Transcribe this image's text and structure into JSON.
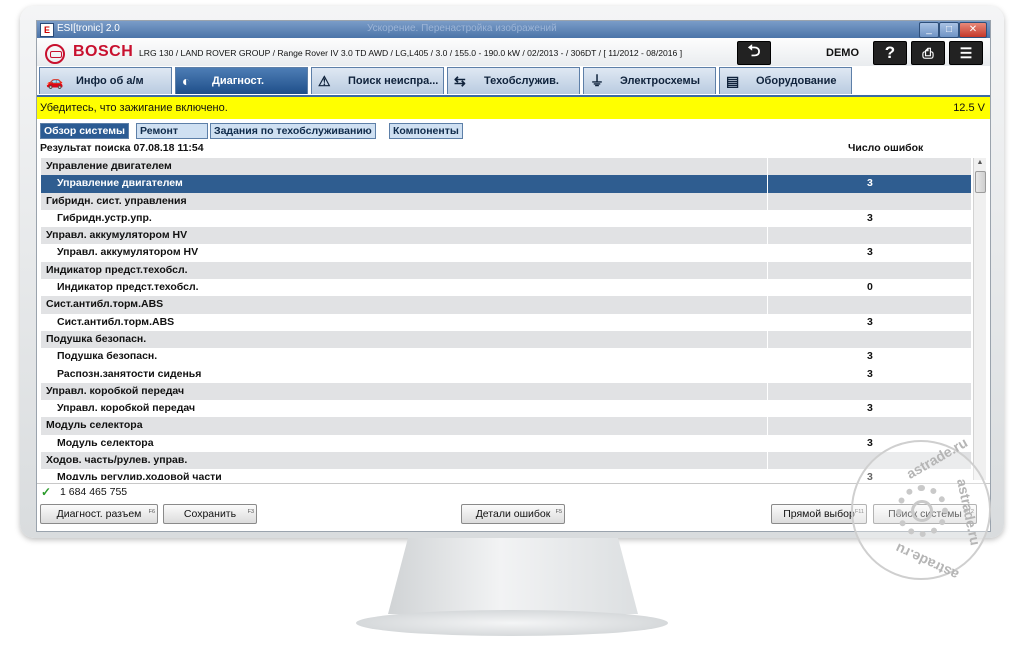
{
  "window": {
    "title": "ESI[tronic] 2.0",
    "ghost_title": "Ускорение. Перенастройка изображений",
    "controls": {
      "minimize": "_",
      "maximize": "□",
      "close": "✕"
    }
  },
  "header": {
    "brand": "BOSCH",
    "vehicle": "LRG 130 / LAND ROVER GROUP / Range Rover IV 3.0 TD AWD / LG,L405 / 3.0 / 155.0 - 190.0 kW / 02/2013 - / 306DT / [ 11/2012 - 08/2016 ]",
    "mode": "DEMO",
    "icons": {
      "back": "back-arrow-icon",
      "help": "help-icon",
      "print": "printer-icon",
      "menu": "menu-icon"
    },
    "glyphs": {
      "back": "⮌",
      "help": "?",
      "print": "⎙",
      "menu": "☰"
    }
  },
  "main_tabs": [
    {
      "label": "Инфо об а/м",
      "icon": "car-info-icon",
      "glyph": "🚗"
    },
    {
      "label": "Диагност.",
      "icon": "diagnostics-icon",
      "glyph": "◐"
    },
    {
      "label": "Поиск неиспра...",
      "icon": "fault-search-icon",
      "glyph": "⚠"
    },
    {
      "label": "Техобслужив.",
      "icon": "service-icon",
      "glyph": "⇆"
    },
    {
      "label": "Электросхемы",
      "icon": "wiring-diagram-icon",
      "glyph": "⏚"
    },
    {
      "label": "Оборудование",
      "icon": "equipment-book-icon",
      "glyph": "▤"
    }
  ],
  "warning": {
    "message": "Убедитесь, что зажигание включено.",
    "voltage": "12.5 V",
    "color": "#ffff00"
  },
  "sub_tabs": [
    {
      "label": "Обзор системы"
    },
    {
      "label": "Ремонт"
    },
    {
      "label": "Задания по техобслуживанию"
    },
    {
      "label": "Компоненты"
    }
  ],
  "result": {
    "label": "Результат поиска  07.08.18  11:54",
    "error_count_header": "Число ошибок"
  },
  "systems": [
    {
      "type": "group",
      "label": "Управление двигателем",
      "count": ""
    },
    {
      "type": "item",
      "label": "Управление двигателем",
      "count": "3",
      "selected": true
    },
    {
      "type": "group",
      "label": "Гибридн. сист. управления",
      "count": ""
    },
    {
      "type": "item",
      "label": "Гибридн.устр.упр.",
      "count": "3"
    },
    {
      "type": "group",
      "label": "Управл. аккумулятором HV",
      "count": ""
    },
    {
      "type": "item",
      "label": "Управл. аккумулятором HV",
      "count": "3"
    },
    {
      "type": "group",
      "label": "Индикатор предст.техобсл.",
      "count": ""
    },
    {
      "type": "item",
      "label": "Индикатор предст.техобсл.",
      "count": "0"
    },
    {
      "type": "group",
      "label": "Сист.антибл.торм.ABS",
      "count": ""
    },
    {
      "type": "item",
      "label": "Сист.антибл.торм.ABS",
      "count": "3"
    },
    {
      "type": "group",
      "label": "Подушка безопасн.",
      "count": ""
    },
    {
      "type": "item",
      "label": "Подушка безопасн.",
      "count": "3"
    },
    {
      "type": "item",
      "label": "Распозн.занятости сиденья",
      "count": "3"
    },
    {
      "type": "group",
      "label": "Управл. коробкой передач",
      "count": ""
    },
    {
      "type": "item",
      "label": "Управл. коробкой передач",
      "count": "3"
    },
    {
      "type": "group",
      "label": "Модуль селектора",
      "count": ""
    },
    {
      "type": "item",
      "label": "Модуль селектора",
      "count": "3"
    },
    {
      "type": "group",
      "label": "Ходов. часть/рулев. управ.",
      "count": ""
    },
    {
      "type": "item",
      "label": "Модуль регулир.ходовой части",
      "count": "3"
    }
  ],
  "status": {
    "check": "✓",
    "number": "1 684 465 755"
  },
  "buttons": {
    "diag_connector": {
      "label": "Диагност. разъем",
      "fkey": "F6"
    },
    "save": {
      "label": "Сохранить",
      "fkey": "F3"
    },
    "fault_details": {
      "label": "Детали ошибок",
      "fkey": "F5"
    },
    "direct_select": {
      "label": "Прямой выбор",
      "fkey": "F11"
    },
    "system_search": {
      "label": "Поиск системы",
      "fkey": "F12"
    }
  },
  "watermark": {
    "text_top": "astrade.ru",
    "text_side": "astrade.ru",
    "text_bottom": "astrade.ru"
  }
}
